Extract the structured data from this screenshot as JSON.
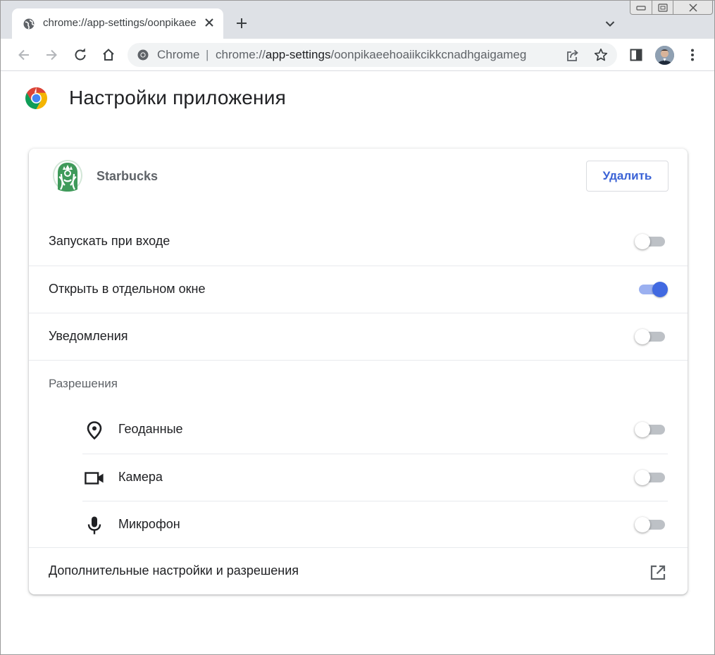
{
  "browser": {
    "tab": {
      "title": "chrome://app-settings/oonpikaeehoaiikcikkcnadhgaigameg"
    },
    "omnibox": {
      "chip": "Chrome",
      "separator": "|",
      "url_scheme": "chrome://",
      "url_host": "app-settings",
      "url_path": "/oonpikaeehoaiikcikkcnadhgaigameg"
    }
  },
  "page": {
    "title": "Настройки приложения"
  },
  "app": {
    "name": "Starbucks",
    "remove_label": "Удалить",
    "brand_color": "#00704A"
  },
  "settings": {
    "run_on_login": {
      "label": "Запускать при входе",
      "enabled": false
    },
    "open_in_window": {
      "label": "Открыть в отдельном окне",
      "enabled": true
    },
    "notifications": {
      "label": "Уведомления",
      "enabled": false
    }
  },
  "permissions": {
    "label": "Разрешения",
    "location": {
      "label": "Геоданные",
      "icon": "location-pin-icon",
      "enabled": false
    },
    "camera": {
      "label": "Камера",
      "icon": "camera-icon",
      "enabled": false
    },
    "microphone": {
      "label": "Микрофон",
      "icon": "microphone-icon",
      "enabled": false
    }
  },
  "more": {
    "label": "Дополнительные настройки и разрешения",
    "icon": "open-external-icon"
  },
  "colors": {
    "accent": "#4169e1",
    "tabstrip": "#dee1e6"
  }
}
